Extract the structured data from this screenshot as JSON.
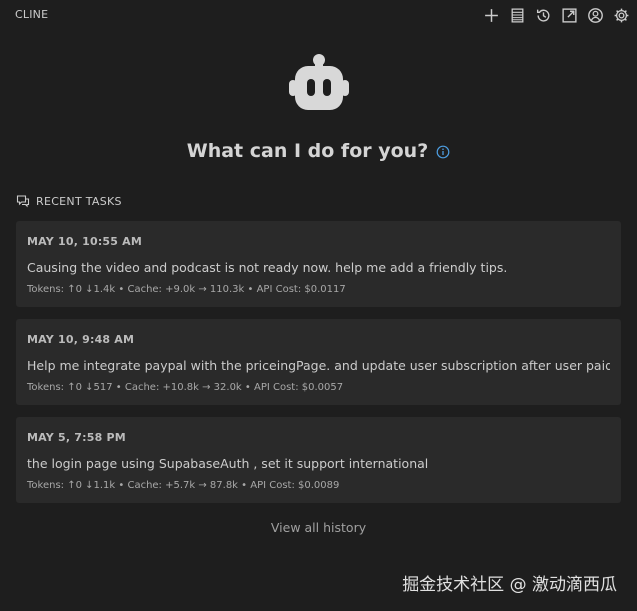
{
  "header": {
    "title": "CLINE",
    "toolbar": [
      "plus-icon",
      "server-icon",
      "history-icon",
      "external-link-icon",
      "account-icon",
      "settings-icon"
    ]
  },
  "welcome": {
    "headline": "What can I do for you?"
  },
  "recent": {
    "label": "RECENT TASKS",
    "tasks": [
      {
        "date": "MAY 10, 10:55 AM",
        "text": "Causing the video and podcast is not ready now. help me add a friendly tips.",
        "meta": "Tokens: ↑0 ↓1.4k • Cache: +9.0k → 110.3k • API Cost: $0.0117"
      },
      {
        "date": "MAY 10, 9:48 AM",
        "text": "Help me integrate paypal with the priceingPage. and update user subscription after user paid.",
        "meta": "Tokens: ↑0 ↓517 • Cache: +10.8k → 32.0k • API Cost: $0.0057"
      },
      {
        "date": "MAY 5, 7:58 PM",
        "text": "the login page using SupabaseAuth , set it support international",
        "meta": "Tokens: ↑0 ↓1.1k • Cache: +5.7k → 87.8k • API Cost: $0.0089"
      }
    ],
    "view_all": "View all history"
  },
  "watermark": "掘金技术社区 @ 激动滴西瓜",
  "colors": {
    "background": "#1e1e1e",
    "card": "#2a2a2a",
    "info_accent": "#4d9de0"
  }
}
